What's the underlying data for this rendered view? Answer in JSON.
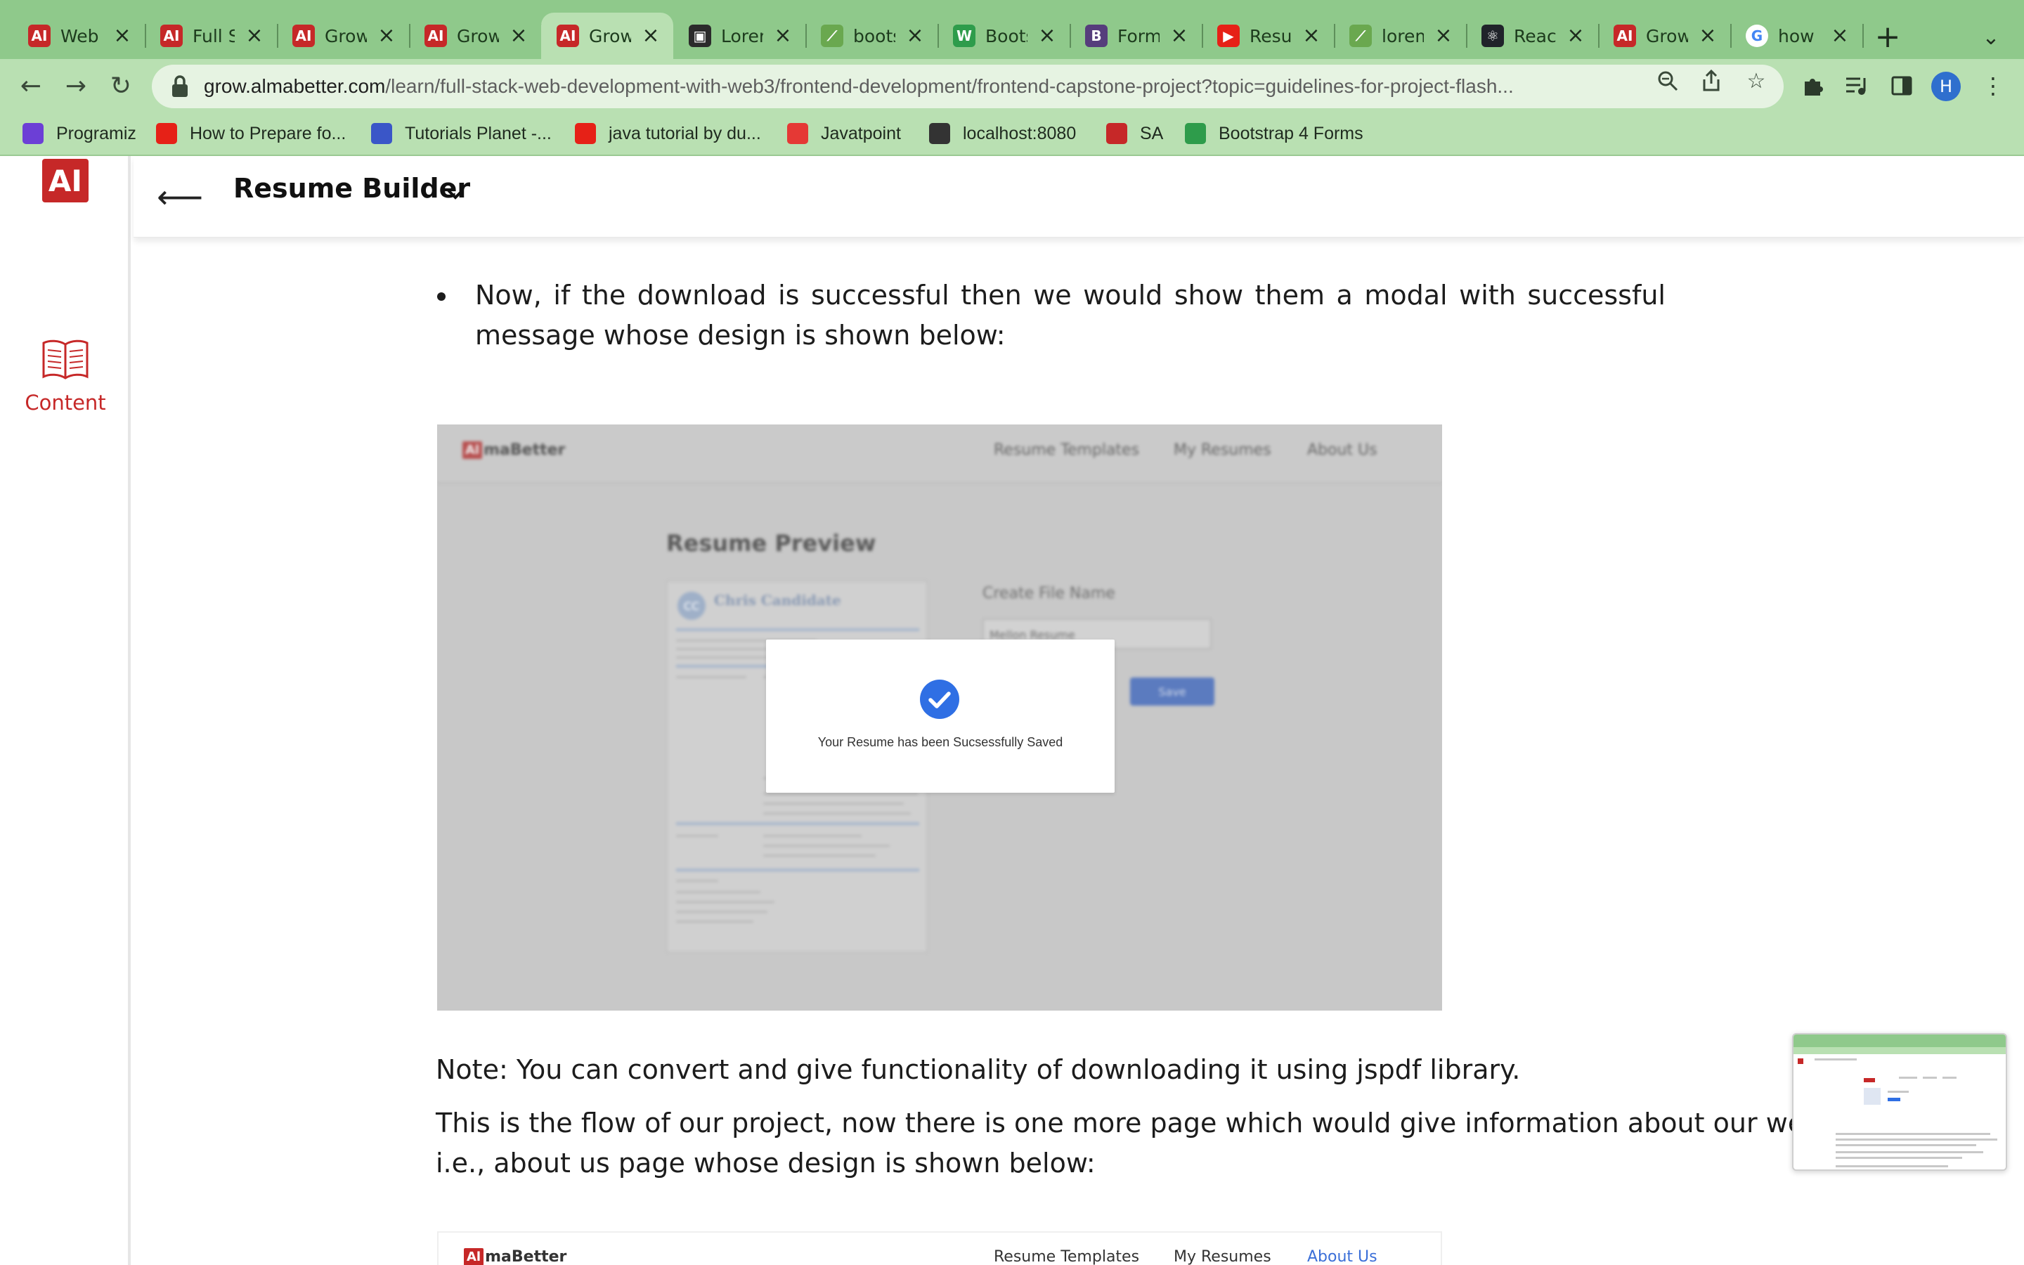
{
  "browser": {
    "tabs": [
      {
        "title": "Web Development",
        "icon": "almabetter-favicon",
        "color": "#c62828",
        "glyph": "AI"
      },
      {
        "title": "Full Stack",
        "icon": "almabetter-favicon",
        "color": "#c62828",
        "glyph": "AI"
      },
      {
        "title": "Grow",
        "icon": "almabetter-favicon",
        "color": "#c62828",
        "glyph": "AI"
      },
      {
        "title": "Grow",
        "icon": "almabetter-favicon",
        "color": "#c62828",
        "glyph": "AI"
      },
      {
        "title": "Grow",
        "icon": "almabetter-favicon",
        "color": "#c62828",
        "glyph": "AI",
        "active": true
      },
      {
        "title": "Lorem",
        "icon": "codepen-favicon",
        "color": "#2b2b2b",
        "glyph": "▣"
      },
      {
        "title": "bootstrap",
        "icon": "bootsnipp-favicon",
        "color": "#6aa84f",
        "glyph": "⟋"
      },
      {
        "title": "Bootstrap",
        "icon": "w3schools-favicon",
        "color": "#2e9c4b",
        "glyph": "W"
      },
      {
        "title": "Forms",
        "icon": "bootstrap-favicon",
        "color": "#563d7c",
        "glyph": "B"
      },
      {
        "title": "Resume",
        "icon": "youtube-favicon",
        "color": "#e62117",
        "glyph": "▶"
      },
      {
        "title": "lorem",
        "icon": "bootsnipp-favicon",
        "color": "#6aa84f",
        "glyph": "⟋"
      },
      {
        "title": "React",
        "icon": "react-favicon",
        "color": "#20232a",
        "glyph": "⚛"
      },
      {
        "title": "Grow",
        "icon": "almabetter-favicon",
        "color": "#c62828",
        "glyph": "AI"
      },
      {
        "title": "how to",
        "icon": "google-favicon",
        "color": "#ffffff",
        "glyph": "G"
      }
    ],
    "url_host": "grow.almabetter.com",
    "url_path": "/learn/full-stack-web-development-with-web3/frontend-development/frontend-capstone-project?topic=guidelines-for-project-flash...",
    "profile_initial": "H",
    "bookmarks": [
      {
        "label": "Programiz",
        "icon": "programiz-icon",
        "color": "#6c3fd6"
      },
      {
        "label": "How to Prepare fo...",
        "icon": "youtube-icon",
        "color": "#e62117"
      },
      {
        "label": "Tutorials Planet -...",
        "icon": "tutorials-planet-icon",
        "color": "#3a56c8"
      },
      {
        "label": "java tutorial by du...",
        "icon": "youtube-icon",
        "color": "#e62117"
      },
      {
        "label": "Javatpoint",
        "icon": "javatpoint-icon",
        "color": "#e53935"
      },
      {
        "label": "localhost:8080",
        "icon": "globe-icon",
        "color": "#333333"
      },
      {
        "label": "SA",
        "icon": "almabetter-icon",
        "color": "#c62828"
      },
      {
        "label": "Bootstrap 4 Forms",
        "icon": "w3schools-icon",
        "color": "#2e9c4b"
      }
    ]
  },
  "sidebar": {
    "logo": "AI",
    "content_label": "Content"
  },
  "header": {
    "title": "Resume Builder"
  },
  "article": {
    "bullet_text": "Now, if the download is successful then we would show them a modal with successful message whose design is shown below:",
    "note": "Note: You can convert and give functionality of downloading it using jspdf library.",
    "flow_text": "This is the flow of our project, now there is one more page which would give information about our website i.e., about us page whose design is shown below:"
  },
  "design_image": {
    "logo_text": "maBetter",
    "logo_mark": "Al",
    "nav": [
      "Resume Templates",
      "My Resumes",
      "About Us"
    ],
    "preview_title": "Resume Preview",
    "candidate_initials": "CC",
    "candidate_name": "Chris Candidate",
    "file_name_label": "Create File Name",
    "file_name_value": "Mellon Resume",
    "save_label": "Save",
    "modal_message": "Your Resume has been Sucsessfully Saved"
  },
  "design_image_2": {
    "logo_text": "maBetter",
    "logo_mark": "Al",
    "nav": [
      "Resume Templates",
      "My Resumes",
      "About Us"
    ],
    "active_nav": "About Us"
  },
  "colors": {
    "brand_red": "#c62828",
    "chrome_green": "#8fc98b",
    "toolbar_green": "#b9e0b2",
    "check_blue": "#2f6fe4"
  }
}
